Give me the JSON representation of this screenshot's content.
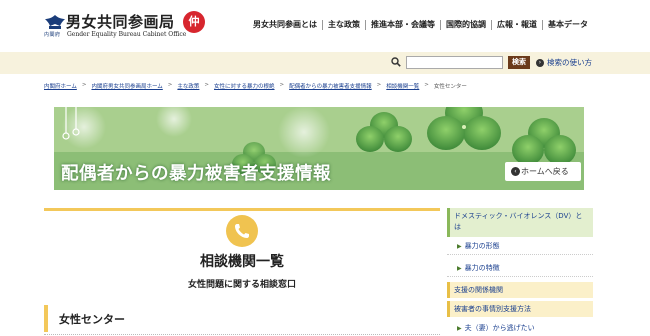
{
  "header": {
    "logo_title": "男女共同参画局",
    "logo_subtitle": "Gender Equality Bureau Cabinet Office",
    "logo_cabinet": "内閣府",
    "logo_mark": "仲",
    "nav": [
      {
        "label": "男女共同参画とは"
      },
      {
        "label": "主な政策"
      },
      {
        "label": "推進本部・会議等"
      },
      {
        "label": "国際的協調"
      },
      {
        "label": "広報・報道"
      },
      {
        "label": "基本データ"
      }
    ]
  },
  "search": {
    "placeholder": "",
    "button_label": "検索",
    "help_label": "検索の使い方",
    "help_arrow": "›"
  },
  "breadcrumb": {
    "items": [
      {
        "label": "内閣府ホーム"
      },
      {
        "label": "内閣府男女共同参画局ホーム"
      },
      {
        "label": "主な政策"
      },
      {
        "label": "女性に対する暴力の根絶"
      },
      {
        "label": "配偶者からの暴力被害者支援情報"
      },
      {
        "label": "相談機関一覧"
      }
    ],
    "separator": ">",
    "current": "女性センター"
  },
  "banner": {
    "title": "配偶者からの暴力被害者支援情報",
    "home_button": "ホームへ戻る",
    "home_arrow": "‹"
  },
  "main": {
    "title": "相談機関一覧",
    "subtitle": "女性問題に関する相談窓口",
    "section_title": "女性センター"
  },
  "sidebar": {
    "items": [
      {
        "label": "ドメスティック・バイオレンス（DV）とは",
        "style": "green"
      },
      {
        "label": "暴力の形態",
        "style": "sub"
      },
      {
        "label": "暴力の特徴",
        "style": "sub"
      },
      {
        "label": "支援の関係機関",
        "style": "yellow"
      },
      {
        "label": "被害者の事情別支援方法",
        "style": "yellow"
      },
      {
        "label": "夫（妻）から逃げたい",
        "style": "sub"
      }
    ],
    "sub_arrow": "▶"
  },
  "colors": {
    "accent_yellow": "#f3c85a",
    "search_bar_bg": "#f7f2dd",
    "search_button": "#6b3a1a",
    "link_blue": "#1a3f8f",
    "logo_red": "#d7262e"
  }
}
